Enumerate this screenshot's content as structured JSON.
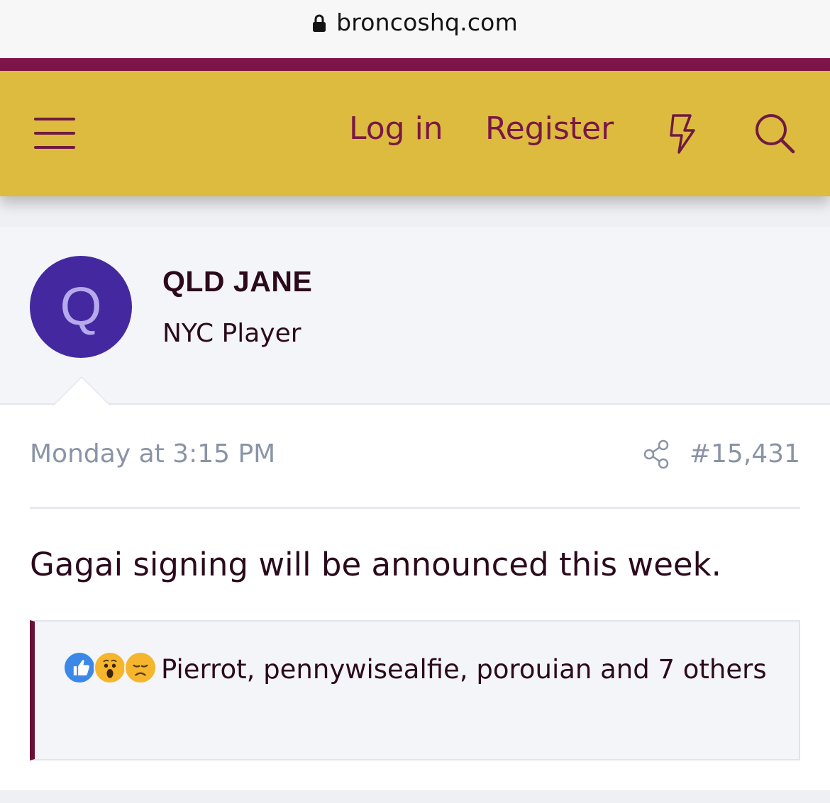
{
  "browser": {
    "url": "broncoshq.com"
  },
  "colors": {
    "brand": "#7d1549",
    "navbar": "#dcbb3f",
    "avatar": "#4428a0",
    "meta": "#8a94a6"
  },
  "nav": {
    "menu_icon": "hamburger-icon",
    "login_label": "Log in",
    "register_label": "Register",
    "whats_new_icon": "bolt-icon",
    "search_icon": "search-icon"
  },
  "post": {
    "avatar_letter": "Q",
    "username": "QLD JANE",
    "user_title": "NYC Player",
    "date": "Monday at 3:15 PM",
    "share_icon": "share-icon",
    "post_number": "#15,431",
    "message": "Gagai signing will be announced this week.",
    "reactions": {
      "icons": [
        "like-icon",
        "wow-icon",
        "sad-icon"
      ],
      "text": "Pierrot, pennywisealfie, porouian and 7 others"
    }
  }
}
